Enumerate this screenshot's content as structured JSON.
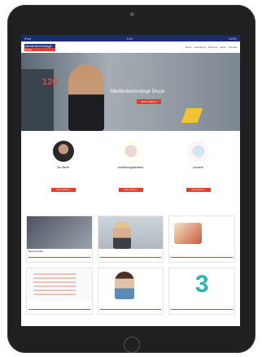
{
  "status": {
    "carrier": "iPad",
    "time": "9:41",
    "battery": "100%"
  },
  "nav": {
    "logo_top": "Medientechnologe",
    "logo_bottom": "Druck",
    "menu": [
      "Beruf",
      "Ausbildung",
      "Betriebe",
      "News",
      "Kontakt"
    ]
  },
  "hero": {
    "title": "Medientechnologe Druck",
    "number": "120",
    "cta": "Mehr erfahren"
  },
  "features": [
    {
      "label": "Der Beruf",
      "text": "",
      "button": "Mehr erfahren"
    },
    {
      "label": "Ausbildungsbetriebe",
      "text": "",
      "button": "Mehr erfahren"
    },
    {
      "label": "Karriere",
      "text": "",
      "button": "Mehr erfahren"
    }
  ],
  "cards": [
    {
      "title": "Berufsporträt"
    },
    {
      "title": ""
    },
    {
      "title": ""
    },
    {
      "title": ""
    },
    {
      "title": ""
    },
    {
      "title": ""
    }
  ],
  "colors": {
    "accent": "#e0412c",
    "brand": "#1a3a8c",
    "statusbar": "#1a2d6b",
    "teal": "#2ab3b3"
  },
  "icons": {
    "camera": "camera-icon",
    "home": "home-button-icon"
  }
}
